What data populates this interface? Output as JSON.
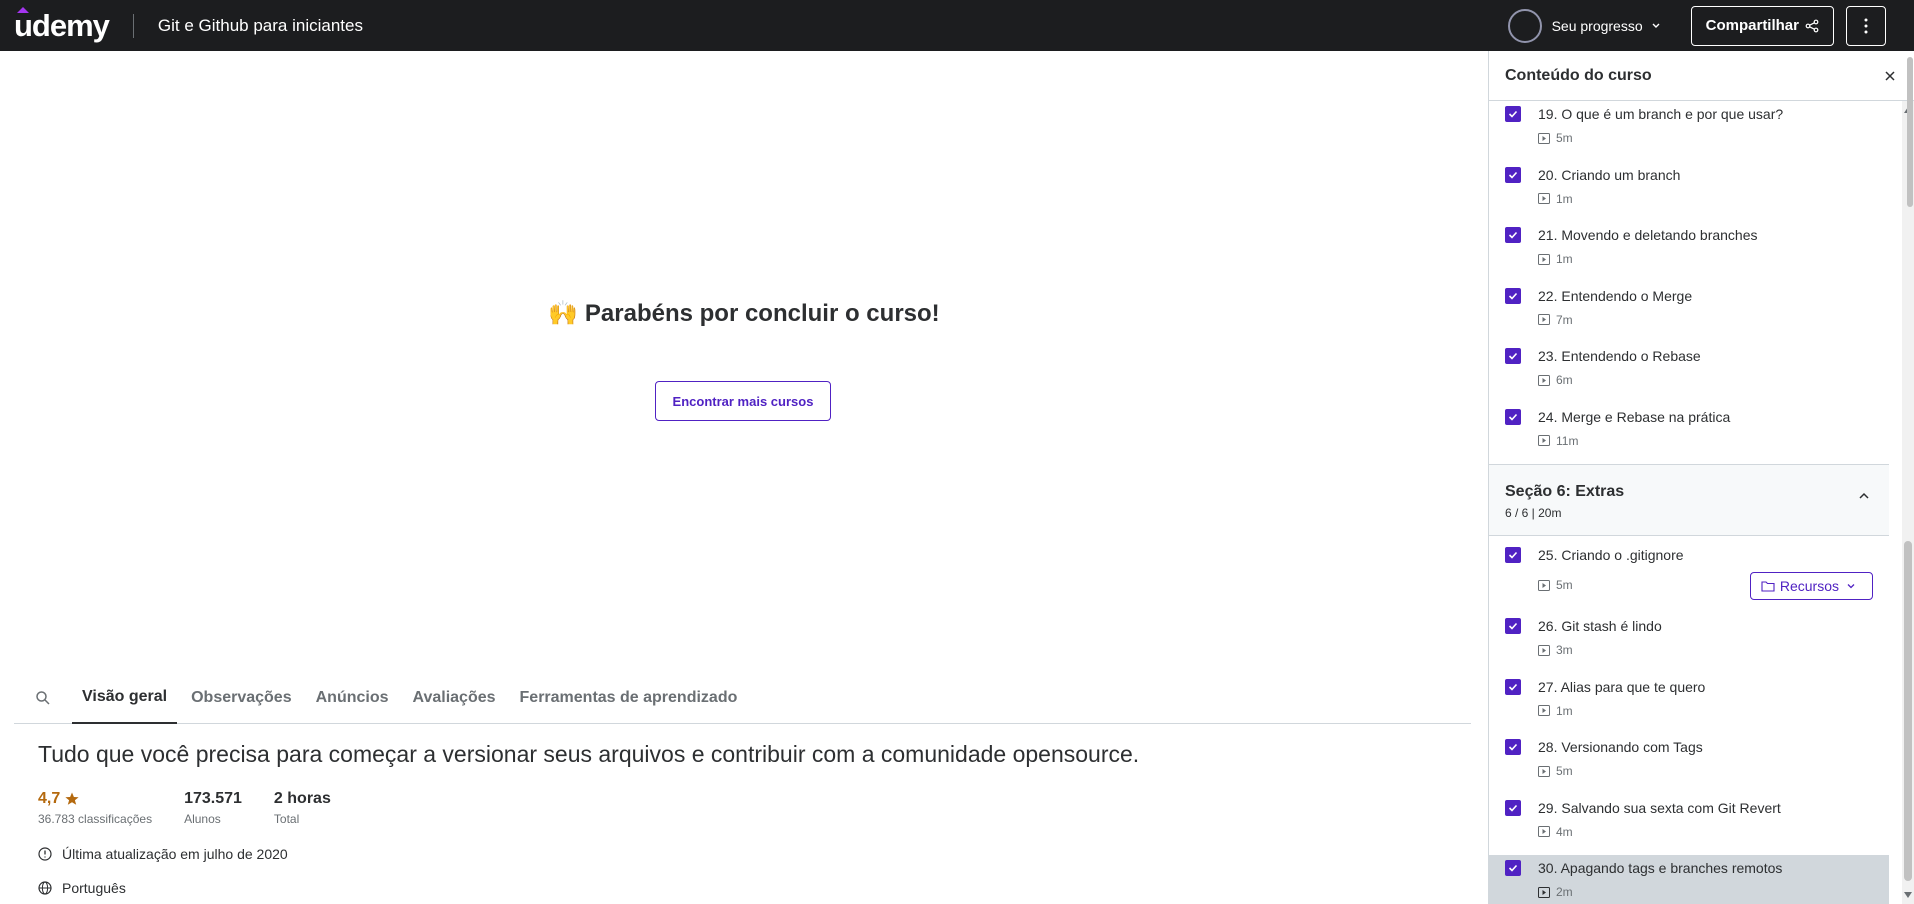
{
  "brand": {
    "logo_text": "udemy",
    "accent": "#a435f0"
  },
  "header": {
    "course_title": "Git e Github para iniciantes",
    "progress_label": "Seu progresso",
    "share_label": "Compartilhar"
  },
  "main": {
    "congrats_emoji": "🙌",
    "congrats_text": "Parabéns por concluir o curso!",
    "find_more_label": "Encontrar mais cursos"
  },
  "tabs": [
    {
      "label": "Visão geral",
      "active": true
    },
    {
      "label": "Observações",
      "active": false
    },
    {
      "label": "Anúncios",
      "active": false
    },
    {
      "label": "Avaliações",
      "active": false
    },
    {
      "label": "Ferramentas de aprendizado",
      "active": false
    }
  ],
  "overview": {
    "tagline": "Tudo que você precisa para começar a versionar seus arquivos e contribuir com a comunidade opensource.",
    "rating": "4,7",
    "rating_count": "36.783 classificações",
    "students": "173.571",
    "students_label": "Alunos",
    "duration": "2 horas",
    "duration_label": "Total",
    "last_update": "Última atualização em julho de 2020",
    "language": "Português"
  },
  "sidebar": {
    "title": "Conteúdo do curso",
    "lectures_a": [
      {
        "title": "19. O que é um branch e por que usar?",
        "duration": "5m"
      },
      {
        "title": "20. Criando um branch",
        "duration": "1m"
      },
      {
        "title": "21. Movendo e deletando branches",
        "duration": "1m"
      },
      {
        "title": "22. Entendendo o Merge",
        "duration": "7m"
      },
      {
        "title": "23. Entendendo o Rebase",
        "duration": "6m"
      },
      {
        "title": "24. Merge e Rebase na prática",
        "duration": "11m"
      }
    ],
    "section": {
      "title": "Seção 6: Extras",
      "meta": "6 / 6 | 20m"
    },
    "lectures_b": [
      {
        "title": "25. Criando o .gitignore",
        "duration": "5m",
        "resources": "Recursos"
      },
      {
        "title": "26. Git stash é lindo",
        "duration": "3m"
      },
      {
        "title": "27. Alias para que te quero",
        "duration": "1m"
      },
      {
        "title": "28. Versionando com Tags",
        "duration": "5m"
      },
      {
        "title": "29. Salvando sua sexta com Git Revert",
        "duration": "4m"
      },
      {
        "title": "30. Apagando tags e branches remotos",
        "duration": "2m"
      }
    ]
  }
}
